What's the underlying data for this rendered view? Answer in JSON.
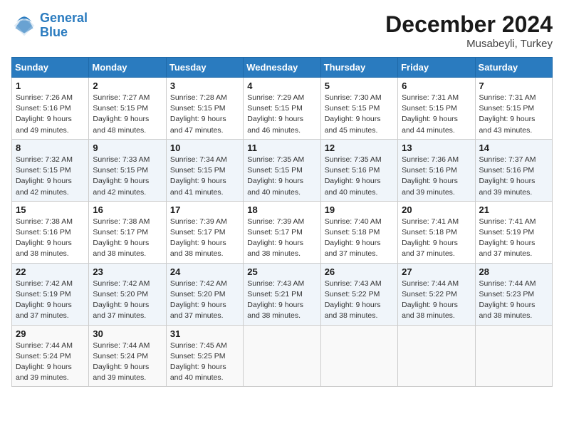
{
  "header": {
    "logo_line1": "General",
    "logo_line2": "Blue",
    "month": "December 2024",
    "location": "Musabeyli, Turkey"
  },
  "weekdays": [
    "Sunday",
    "Monday",
    "Tuesday",
    "Wednesday",
    "Thursday",
    "Friday",
    "Saturday"
  ],
  "weeks": [
    [
      {
        "day": "1",
        "sunrise": "Sunrise: 7:26 AM",
        "sunset": "Sunset: 5:16 PM",
        "daylight": "Daylight: 9 hours and 49 minutes."
      },
      {
        "day": "2",
        "sunrise": "Sunrise: 7:27 AM",
        "sunset": "Sunset: 5:15 PM",
        "daylight": "Daylight: 9 hours and 48 minutes."
      },
      {
        "day": "3",
        "sunrise": "Sunrise: 7:28 AM",
        "sunset": "Sunset: 5:15 PM",
        "daylight": "Daylight: 9 hours and 47 minutes."
      },
      {
        "day": "4",
        "sunrise": "Sunrise: 7:29 AM",
        "sunset": "Sunset: 5:15 PM",
        "daylight": "Daylight: 9 hours and 46 minutes."
      },
      {
        "day": "5",
        "sunrise": "Sunrise: 7:30 AM",
        "sunset": "Sunset: 5:15 PM",
        "daylight": "Daylight: 9 hours and 45 minutes."
      },
      {
        "day": "6",
        "sunrise": "Sunrise: 7:31 AM",
        "sunset": "Sunset: 5:15 PM",
        "daylight": "Daylight: 9 hours and 44 minutes."
      },
      {
        "day": "7",
        "sunrise": "Sunrise: 7:31 AM",
        "sunset": "Sunset: 5:15 PM",
        "daylight": "Daylight: 9 hours and 43 minutes."
      }
    ],
    [
      {
        "day": "8",
        "sunrise": "Sunrise: 7:32 AM",
        "sunset": "Sunset: 5:15 PM",
        "daylight": "Daylight: 9 hours and 42 minutes."
      },
      {
        "day": "9",
        "sunrise": "Sunrise: 7:33 AM",
        "sunset": "Sunset: 5:15 PM",
        "daylight": "Daylight: 9 hours and 42 minutes."
      },
      {
        "day": "10",
        "sunrise": "Sunrise: 7:34 AM",
        "sunset": "Sunset: 5:15 PM",
        "daylight": "Daylight: 9 hours and 41 minutes."
      },
      {
        "day": "11",
        "sunrise": "Sunrise: 7:35 AM",
        "sunset": "Sunset: 5:15 PM",
        "daylight": "Daylight: 9 hours and 40 minutes."
      },
      {
        "day": "12",
        "sunrise": "Sunrise: 7:35 AM",
        "sunset": "Sunset: 5:16 PM",
        "daylight": "Daylight: 9 hours and 40 minutes."
      },
      {
        "day": "13",
        "sunrise": "Sunrise: 7:36 AM",
        "sunset": "Sunset: 5:16 PM",
        "daylight": "Daylight: 9 hours and 39 minutes."
      },
      {
        "day": "14",
        "sunrise": "Sunrise: 7:37 AM",
        "sunset": "Sunset: 5:16 PM",
        "daylight": "Daylight: 9 hours and 39 minutes."
      }
    ],
    [
      {
        "day": "15",
        "sunrise": "Sunrise: 7:38 AM",
        "sunset": "Sunset: 5:16 PM",
        "daylight": "Daylight: 9 hours and 38 minutes."
      },
      {
        "day": "16",
        "sunrise": "Sunrise: 7:38 AM",
        "sunset": "Sunset: 5:17 PM",
        "daylight": "Daylight: 9 hours and 38 minutes."
      },
      {
        "day": "17",
        "sunrise": "Sunrise: 7:39 AM",
        "sunset": "Sunset: 5:17 PM",
        "daylight": "Daylight: 9 hours and 38 minutes."
      },
      {
        "day": "18",
        "sunrise": "Sunrise: 7:39 AM",
        "sunset": "Sunset: 5:17 PM",
        "daylight": "Daylight: 9 hours and 38 minutes."
      },
      {
        "day": "19",
        "sunrise": "Sunrise: 7:40 AM",
        "sunset": "Sunset: 5:18 PM",
        "daylight": "Daylight: 9 hours and 37 minutes."
      },
      {
        "day": "20",
        "sunrise": "Sunrise: 7:41 AM",
        "sunset": "Sunset: 5:18 PM",
        "daylight": "Daylight: 9 hours and 37 minutes."
      },
      {
        "day": "21",
        "sunrise": "Sunrise: 7:41 AM",
        "sunset": "Sunset: 5:19 PM",
        "daylight": "Daylight: 9 hours and 37 minutes."
      }
    ],
    [
      {
        "day": "22",
        "sunrise": "Sunrise: 7:42 AM",
        "sunset": "Sunset: 5:19 PM",
        "daylight": "Daylight: 9 hours and 37 minutes."
      },
      {
        "day": "23",
        "sunrise": "Sunrise: 7:42 AM",
        "sunset": "Sunset: 5:20 PM",
        "daylight": "Daylight: 9 hours and 37 minutes."
      },
      {
        "day": "24",
        "sunrise": "Sunrise: 7:42 AM",
        "sunset": "Sunset: 5:20 PM",
        "daylight": "Daylight: 9 hours and 37 minutes."
      },
      {
        "day": "25",
        "sunrise": "Sunrise: 7:43 AM",
        "sunset": "Sunset: 5:21 PM",
        "daylight": "Daylight: 9 hours and 38 minutes."
      },
      {
        "day": "26",
        "sunrise": "Sunrise: 7:43 AM",
        "sunset": "Sunset: 5:22 PM",
        "daylight": "Daylight: 9 hours and 38 minutes."
      },
      {
        "day": "27",
        "sunrise": "Sunrise: 7:44 AM",
        "sunset": "Sunset: 5:22 PM",
        "daylight": "Daylight: 9 hours and 38 minutes."
      },
      {
        "day": "28",
        "sunrise": "Sunrise: 7:44 AM",
        "sunset": "Sunset: 5:23 PM",
        "daylight": "Daylight: 9 hours and 38 minutes."
      }
    ],
    [
      {
        "day": "29",
        "sunrise": "Sunrise: 7:44 AM",
        "sunset": "Sunset: 5:24 PM",
        "daylight": "Daylight: 9 hours and 39 minutes."
      },
      {
        "day": "30",
        "sunrise": "Sunrise: 7:44 AM",
        "sunset": "Sunset: 5:24 PM",
        "daylight": "Daylight: 9 hours and 39 minutes."
      },
      {
        "day": "31",
        "sunrise": "Sunrise: 7:45 AM",
        "sunset": "Sunset: 5:25 PM",
        "daylight": "Daylight: 9 hours and 40 minutes."
      },
      null,
      null,
      null,
      null
    ]
  ]
}
